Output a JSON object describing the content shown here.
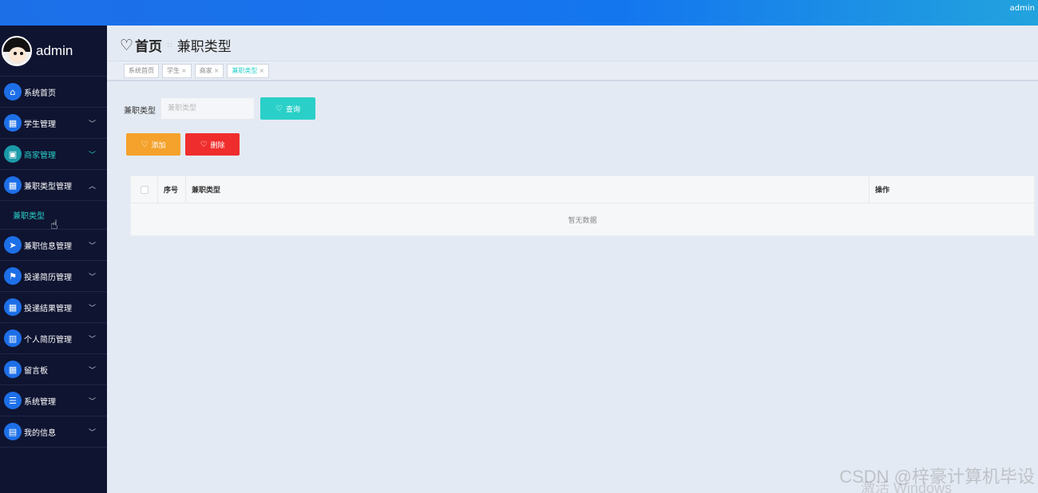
{
  "topbar": {
    "user": "admin"
  },
  "sidebar": {
    "username": "admin",
    "items": [
      {
        "label": "系统首页",
        "icon": "⌂",
        "icon_name": "home-icon",
        "has_chevron": false
      },
      {
        "label": "学生管理",
        "icon": "▦",
        "icon_name": "grid-icon",
        "has_chevron": true
      },
      {
        "label": "商家管理",
        "icon": "▣",
        "icon_name": "store-icon",
        "has_chevron": true
      },
      {
        "label": "兼职类型管理",
        "icon": "▦",
        "icon_name": "grid-icon",
        "has_chevron": true
      },
      {
        "label": "兼职信息管理",
        "icon": "➤",
        "icon_name": "send-icon",
        "has_chevron": true
      },
      {
        "label": "投递简历管理",
        "icon": "⚑",
        "icon_name": "flag-icon",
        "has_chevron": true
      },
      {
        "label": "投递结果管理",
        "icon": "▦",
        "icon_name": "grid-icon",
        "has_chevron": true
      },
      {
        "label": "个人简历管理",
        "icon": "▥",
        "icon_name": "book-icon",
        "has_chevron": true
      },
      {
        "label": "留言板",
        "icon": "▦",
        "icon_name": "grid-icon",
        "has_chevron": true
      },
      {
        "label": "系统管理",
        "icon": "☰",
        "icon_name": "settings-icon",
        "has_chevron": true
      },
      {
        "label": "我的信息",
        "icon": "▤",
        "icon_name": "card-icon",
        "has_chevron": true
      }
    ],
    "submenu_label": "兼职类型"
  },
  "breadcrumb": {
    "home": "首页",
    "separator": "::",
    "current": "兼职类型"
  },
  "tabs": [
    {
      "label": "系统首页",
      "closable": false
    },
    {
      "label": "学生",
      "closable": true
    },
    {
      "label": "商家",
      "closable": true
    },
    {
      "label": "兼职类型",
      "closable": true
    }
  ],
  "search": {
    "label": "兼职类型",
    "placeholder": "兼职类型",
    "query_button": "查询"
  },
  "actions": {
    "add": "添加",
    "delete": "删除"
  },
  "table": {
    "columns": {
      "index": "序号",
      "type": "兼职类型",
      "ops": "操作"
    },
    "empty_text": "暂无数据"
  },
  "watermarks": {
    "csdn": "CSDN @梓豪计算机毕设",
    "windows": "激活 Windows"
  },
  "colors": {
    "accent": "#2ad0c8",
    "primary": "#1d6fe8",
    "warning": "#f4a22b",
    "danger": "#f02d2d",
    "sidebar": "#0f1431"
  }
}
